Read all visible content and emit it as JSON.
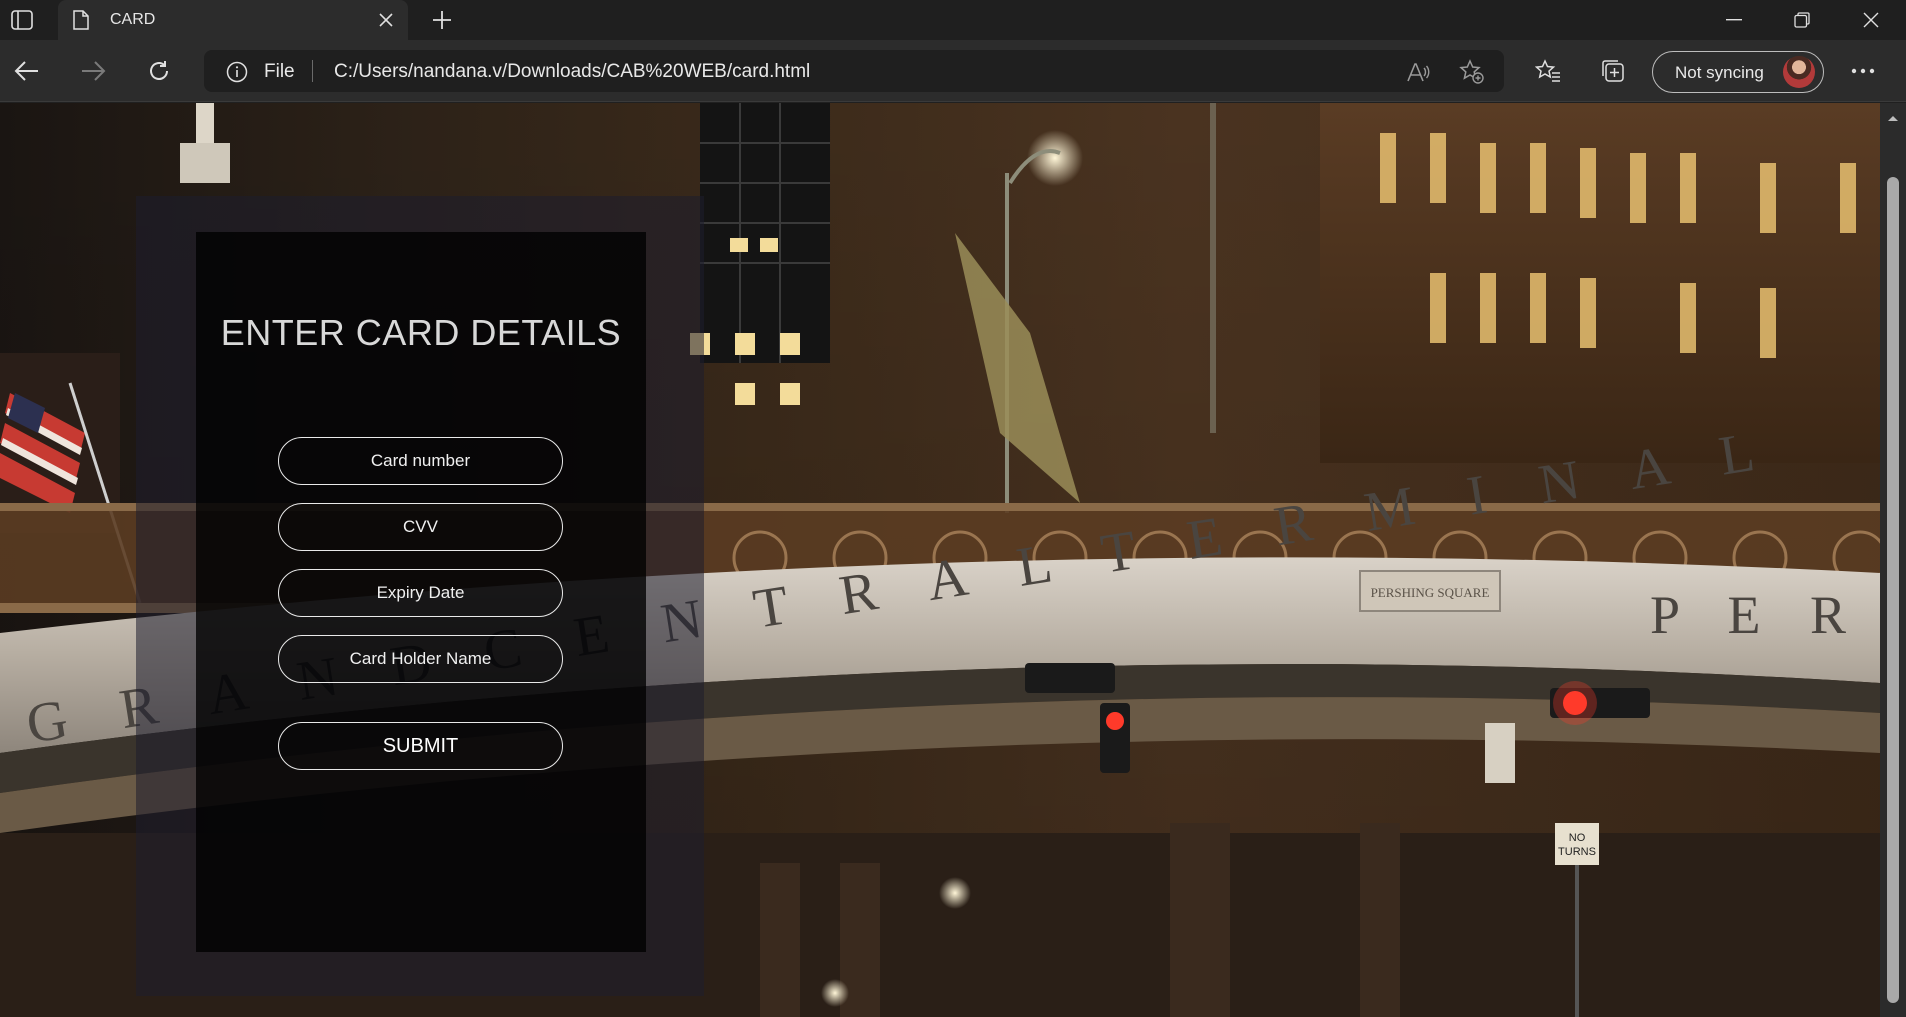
{
  "browser": {
    "tab_title": "CARD",
    "url_scheme": "File",
    "url": "C:/Users/nandana.v/Downloads/CAB%20WEB/card.html",
    "profile_label": "Not syncing"
  },
  "scene": {
    "sign_text_left": "G R A N D   C E N T R A L   T E R M I N A L",
    "sign_text_right": "P E R S H",
    "plaque_text": "PERSHING SQUARE",
    "no_turns_line1": "NO",
    "no_turns_line2": "TURNS"
  },
  "form": {
    "title": "ENTER CARD DETAILS",
    "card_number_placeholder": "Card number",
    "cvv_placeholder": "CVV",
    "expiry_placeholder": "Expiry Date",
    "holder_placeholder": "Card Holder Name",
    "submit_label": "SUBMIT"
  },
  "colors": {
    "chrome_dark": "#1f1f1f",
    "toolbar": "#2c2c2c",
    "panel": "#000000",
    "field_border": "#e9e9e9",
    "text": "#ffffff"
  }
}
